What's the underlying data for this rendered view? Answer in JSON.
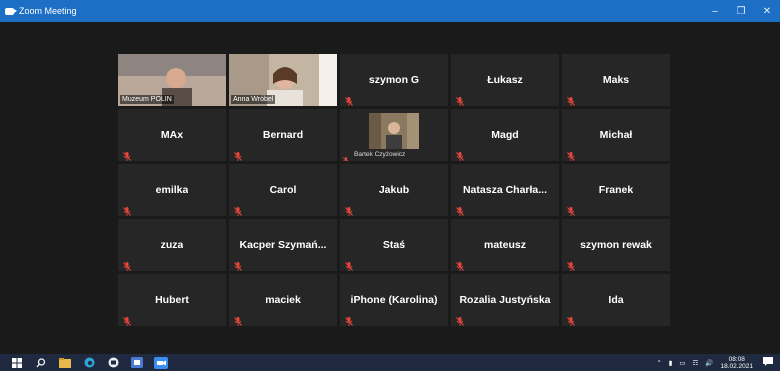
{
  "window": {
    "title": "Zoom Meeting"
  },
  "participants": [
    {
      "name": "Muzeum POLIN",
      "type": "video",
      "active": true
    },
    {
      "name": "Anna Wróbel",
      "type": "video",
      "active": false
    },
    {
      "name": "szymon G",
      "type": "name"
    },
    {
      "name": "Łukasz",
      "type": "name"
    },
    {
      "name": "Maks",
      "type": "name"
    },
    {
      "name": "MAx",
      "type": "name"
    },
    {
      "name": "Bernard",
      "type": "name"
    },
    {
      "name": "Bartek Czyżowicz",
      "type": "small-video"
    },
    {
      "name": "Magd",
      "type": "name"
    },
    {
      "name": "Michał",
      "type": "name"
    },
    {
      "name": "emilka",
      "type": "name"
    },
    {
      "name": "Carol",
      "type": "name"
    },
    {
      "name": "Jakub",
      "type": "name"
    },
    {
      "name": "Natasza Charła...",
      "type": "name"
    },
    {
      "name": "Franek",
      "type": "name"
    },
    {
      "name": "zuza",
      "type": "name"
    },
    {
      "name": "Kacper Szymań...",
      "type": "name"
    },
    {
      "name": "Staś",
      "type": "name"
    },
    {
      "name": "mateusz",
      "type": "name"
    },
    {
      "name": "szymon rewak",
      "type": "name"
    },
    {
      "name": "Hubert",
      "type": "name"
    },
    {
      "name": "maciek",
      "type": "name"
    },
    {
      "name": "iPhone (Karolina)",
      "type": "name"
    },
    {
      "name": "Rozalia Justyńska",
      "type": "name"
    },
    {
      "name": "Ida",
      "type": "name"
    }
  ],
  "taskbar": {
    "time": "08:08",
    "date": "18.02.2021"
  },
  "colors": {
    "titlebar": "#1c6fc5",
    "active_speaker_border": "#b7e13a",
    "muted_mic": "#e8463b",
    "tile_bg": "#262626",
    "background": "#1a1a1a"
  }
}
